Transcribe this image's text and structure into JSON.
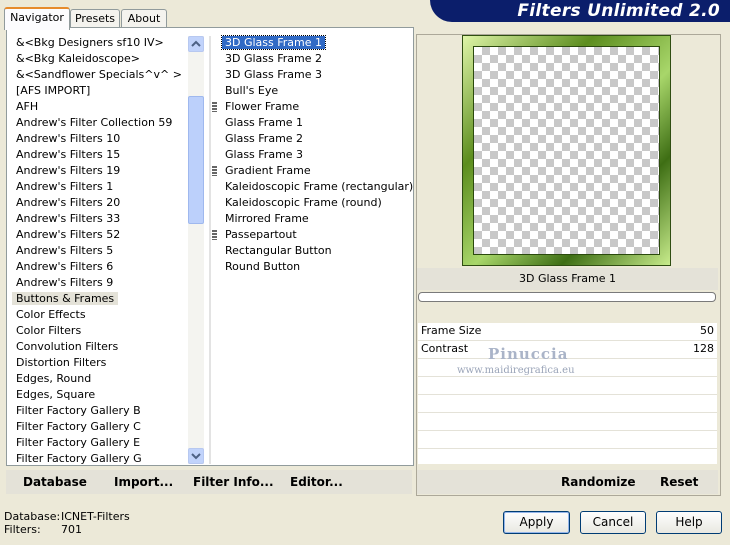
{
  "tabs": [
    {
      "label": "Navigator"
    },
    {
      "label": "Presets"
    },
    {
      "label": "About"
    }
  ],
  "banner_title": "Filters Unlimited 2.0",
  "categories": [
    "&<Bkg Designers sf10 IV>",
    "&<Bkg Kaleidoscope>",
    "&<Sandflower Specials^v^ >",
    "[AFS IMPORT]",
    "AFH",
    "Andrew's Filter Collection 59",
    "Andrew's Filters 10",
    "Andrew's Filters 15",
    "Andrew's Filters 19",
    "Andrew's Filters 1",
    "Andrew's Filters 20",
    "Andrew's Filters 33",
    "Andrew's Filters 52",
    "Andrew's Filters 5",
    "Andrew's Filters 6",
    "Andrew's Filters 9",
    "Buttons & Frames",
    "Color Effects",
    "Color Filters",
    "Convolution Filters",
    "Distortion Filters",
    "Edges, Round",
    "Edges, Square",
    "Filter Factory Gallery B",
    "Filter Factory Gallery C",
    "Filter Factory Gallery E",
    "Filter Factory Gallery G"
  ],
  "filters": [
    "3D Glass Frame 1",
    "3D Glass Frame 2",
    "3D Glass Frame 3",
    "Bull's Eye",
    "Flower Frame",
    "Glass Frame 1",
    "Glass Frame 2",
    "Glass Frame 3",
    "Gradient Frame",
    "Kaleidoscopic Frame (rectangular)",
    "Kaleidoscopic Frame (round)",
    "Mirrored Frame",
    "Passepartout",
    "Rectangular Button",
    "Round Button"
  ],
  "toolbar": {
    "database": "Database",
    "import": "Import...",
    "filter_info": "Filter Info...",
    "editor": "Editor...",
    "randomize": "Randomize",
    "reset": "Reset"
  },
  "preview": {
    "filter_name": "3D Glass Frame 1",
    "frame_color": "#5c8d1e"
  },
  "params": [
    {
      "name": "Frame Size",
      "value": "50"
    },
    {
      "name": "Contrast",
      "value": "128"
    }
  ],
  "watermark": {
    "line1": "Pinuccia",
    "line2": "www.maidiregrafica.eu"
  },
  "footer": {
    "database_label": "Database:",
    "database_value": "ICNET-Filters",
    "filters_label": "Filters:",
    "filters_value": "701"
  },
  "buttons": {
    "apply": "Apply",
    "cancel": "Cancel",
    "help": "Help"
  },
  "icons": {
    "scroll_up": "chevron-up-icon",
    "scroll_down": "chevron-down-icon"
  }
}
